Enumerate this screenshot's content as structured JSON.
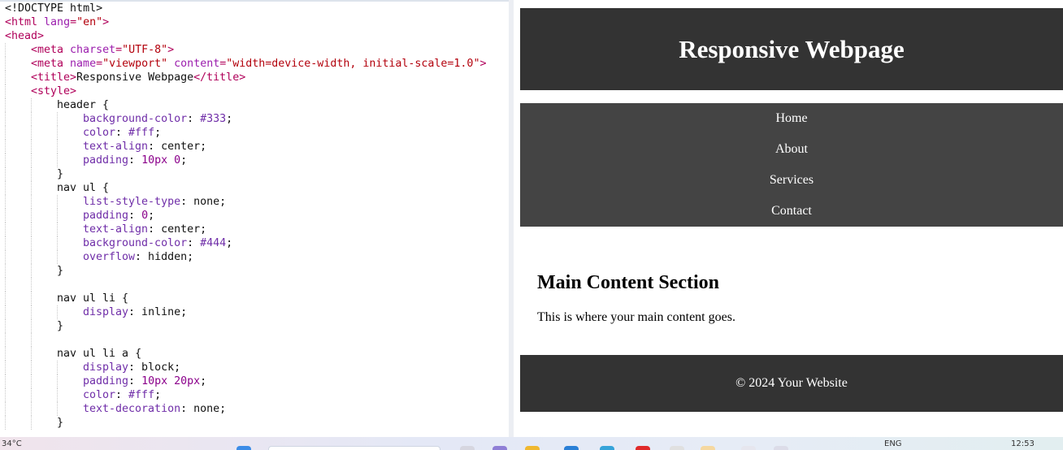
{
  "editor": {
    "lines": [
      {
        "indent": 0,
        "tokens": [
          {
            "c": "txt",
            "t": "<!DOCTYPE html>"
          }
        ]
      },
      {
        "indent": 0,
        "tokens": [
          {
            "c": "tag",
            "t": "<html "
          },
          {
            "c": "attr",
            "t": "lang"
          },
          {
            "c": "tag",
            "t": "="
          },
          {
            "c": "str",
            "t": "\"en\""
          },
          {
            "c": "tag",
            "t": ">"
          }
        ]
      },
      {
        "indent": 0,
        "tokens": [
          {
            "c": "tag",
            "t": "<head>"
          }
        ]
      },
      {
        "indent": 1,
        "tokens": [
          {
            "c": "tag",
            "t": "<meta "
          },
          {
            "c": "attr",
            "t": "charset"
          },
          {
            "c": "tag",
            "t": "="
          },
          {
            "c": "str",
            "t": "\"UTF-8\""
          },
          {
            "c": "tag",
            "t": ">"
          }
        ]
      },
      {
        "indent": 1,
        "tokens": [
          {
            "c": "tag",
            "t": "<meta "
          },
          {
            "c": "attr",
            "t": "name"
          },
          {
            "c": "tag",
            "t": "="
          },
          {
            "c": "str",
            "t": "\"viewport\""
          },
          {
            "c": "tag",
            "t": " "
          },
          {
            "c": "attr",
            "t": "content"
          },
          {
            "c": "tag",
            "t": "="
          },
          {
            "c": "str",
            "t": "\"width=device-width, initial-scale=1.0\""
          },
          {
            "c": "tag",
            "t": ">"
          }
        ]
      },
      {
        "indent": 1,
        "tokens": [
          {
            "c": "tag",
            "t": "<title>"
          },
          {
            "c": "txt",
            "t": "Responsive Webpage"
          },
          {
            "c": "tag",
            "t": "</title>"
          }
        ]
      },
      {
        "indent": 1,
        "tokens": [
          {
            "c": "tag",
            "t": "<style>"
          }
        ]
      },
      {
        "indent": 2,
        "tokens": [
          {
            "c": "txt",
            "t": "header {"
          }
        ]
      },
      {
        "indent": 3,
        "tokens": [
          {
            "c": "prop",
            "t": "background-color"
          },
          {
            "c": "txt",
            "t": ": "
          },
          {
            "c": "prop",
            "t": "#333"
          },
          {
            "c": "txt",
            "t": ";"
          }
        ]
      },
      {
        "indent": 3,
        "tokens": [
          {
            "c": "prop",
            "t": "color"
          },
          {
            "c": "txt",
            "t": ": "
          },
          {
            "c": "prop",
            "t": "#fff"
          },
          {
            "c": "txt",
            "t": ";"
          }
        ]
      },
      {
        "indent": 3,
        "tokens": [
          {
            "c": "prop",
            "t": "text-align"
          },
          {
            "c": "txt",
            "t": ": center;"
          }
        ]
      },
      {
        "indent": 3,
        "tokens": [
          {
            "c": "prop",
            "t": "padding"
          },
          {
            "c": "txt",
            "t": ": "
          },
          {
            "c": "num",
            "t": "10px 0"
          },
          {
            "c": "txt",
            "t": ";"
          }
        ]
      },
      {
        "indent": 2,
        "tokens": [
          {
            "c": "txt",
            "t": "}"
          }
        ]
      },
      {
        "indent": 2,
        "tokens": [
          {
            "c": "txt",
            "t": "nav ul {"
          }
        ]
      },
      {
        "indent": 3,
        "tokens": [
          {
            "c": "prop",
            "t": "list-style-type"
          },
          {
            "c": "txt",
            "t": ": none;"
          }
        ]
      },
      {
        "indent": 3,
        "tokens": [
          {
            "c": "prop",
            "t": "padding"
          },
          {
            "c": "txt",
            "t": ": "
          },
          {
            "c": "num",
            "t": "0"
          },
          {
            "c": "txt",
            "t": ";"
          }
        ]
      },
      {
        "indent": 3,
        "tokens": [
          {
            "c": "prop",
            "t": "text-align"
          },
          {
            "c": "txt",
            "t": ": center;"
          }
        ]
      },
      {
        "indent": 3,
        "tokens": [
          {
            "c": "prop",
            "t": "background-color"
          },
          {
            "c": "txt",
            "t": ": "
          },
          {
            "c": "prop",
            "t": "#444"
          },
          {
            "c": "txt",
            "t": ";"
          }
        ]
      },
      {
        "indent": 3,
        "tokens": [
          {
            "c": "prop",
            "t": "overflow"
          },
          {
            "c": "txt",
            "t": ": hidden;"
          }
        ]
      },
      {
        "indent": 2,
        "tokens": [
          {
            "c": "txt",
            "t": "}"
          }
        ]
      },
      {
        "indent": 2,
        "tokens": []
      },
      {
        "indent": 2,
        "tokens": [
          {
            "c": "txt",
            "t": "nav ul li {"
          }
        ]
      },
      {
        "indent": 3,
        "tokens": [
          {
            "c": "prop",
            "t": "display"
          },
          {
            "c": "txt",
            "t": ": inline;"
          }
        ]
      },
      {
        "indent": 2,
        "tokens": [
          {
            "c": "txt",
            "t": "}"
          }
        ]
      },
      {
        "indent": 2,
        "tokens": []
      },
      {
        "indent": 2,
        "tokens": [
          {
            "c": "txt",
            "t": "nav ul li a {"
          }
        ]
      },
      {
        "indent": 3,
        "tokens": [
          {
            "c": "prop",
            "t": "display"
          },
          {
            "c": "txt",
            "t": ": block;"
          }
        ]
      },
      {
        "indent": 3,
        "tokens": [
          {
            "c": "prop",
            "t": "padding"
          },
          {
            "c": "txt",
            "t": ": "
          },
          {
            "c": "num",
            "t": "10px 20px"
          },
          {
            "c": "txt",
            "t": ";"
          }
        ]
      },
      {
        "indent": 3,
        "tokens": [
          {
            "c": "prop",
            "t": "color"
          },
          {
            "c": "txt",
            "t": ": "
          },
          {
            "c": "prop",
            "t": "#fff"
          },
          {
            "c": "txt",
            "t": ";"
          }
        ]
      },
      {
        "indent": 3,
        "tokens": [
          {
            "c": "prop",
            "t": "text-decoration"
          },
          {
            "c": "txt",
            "t": ": none;"
          }
        ]
      },
      {
        "indent": 2,
        "tokens": [
          {
            "c": "txt",
            "t": "}"
          }
        ]
      }
    ]
  },
  "preview": {
    "header_title": "Responsive Webpage",
    "nav_items": [
      "Home",
      "About",
      "Services",
      "Contact"
    ],
    "main_heading": "Main Content Section",
    "main_text": "This is where your main content goes.",
    "footer_text": "© 2024 Your Website",
    "colors": {
      "header_bg": "#333333",
      "nav_bg": "#444444",
      "footer_bg": "#333333",
      "text_light": "#ffffff"
    }
  },
  "taskbar": {
    "weather": "34°C",
    "language": "ENG",
    "time": "12:53"
  }
}
